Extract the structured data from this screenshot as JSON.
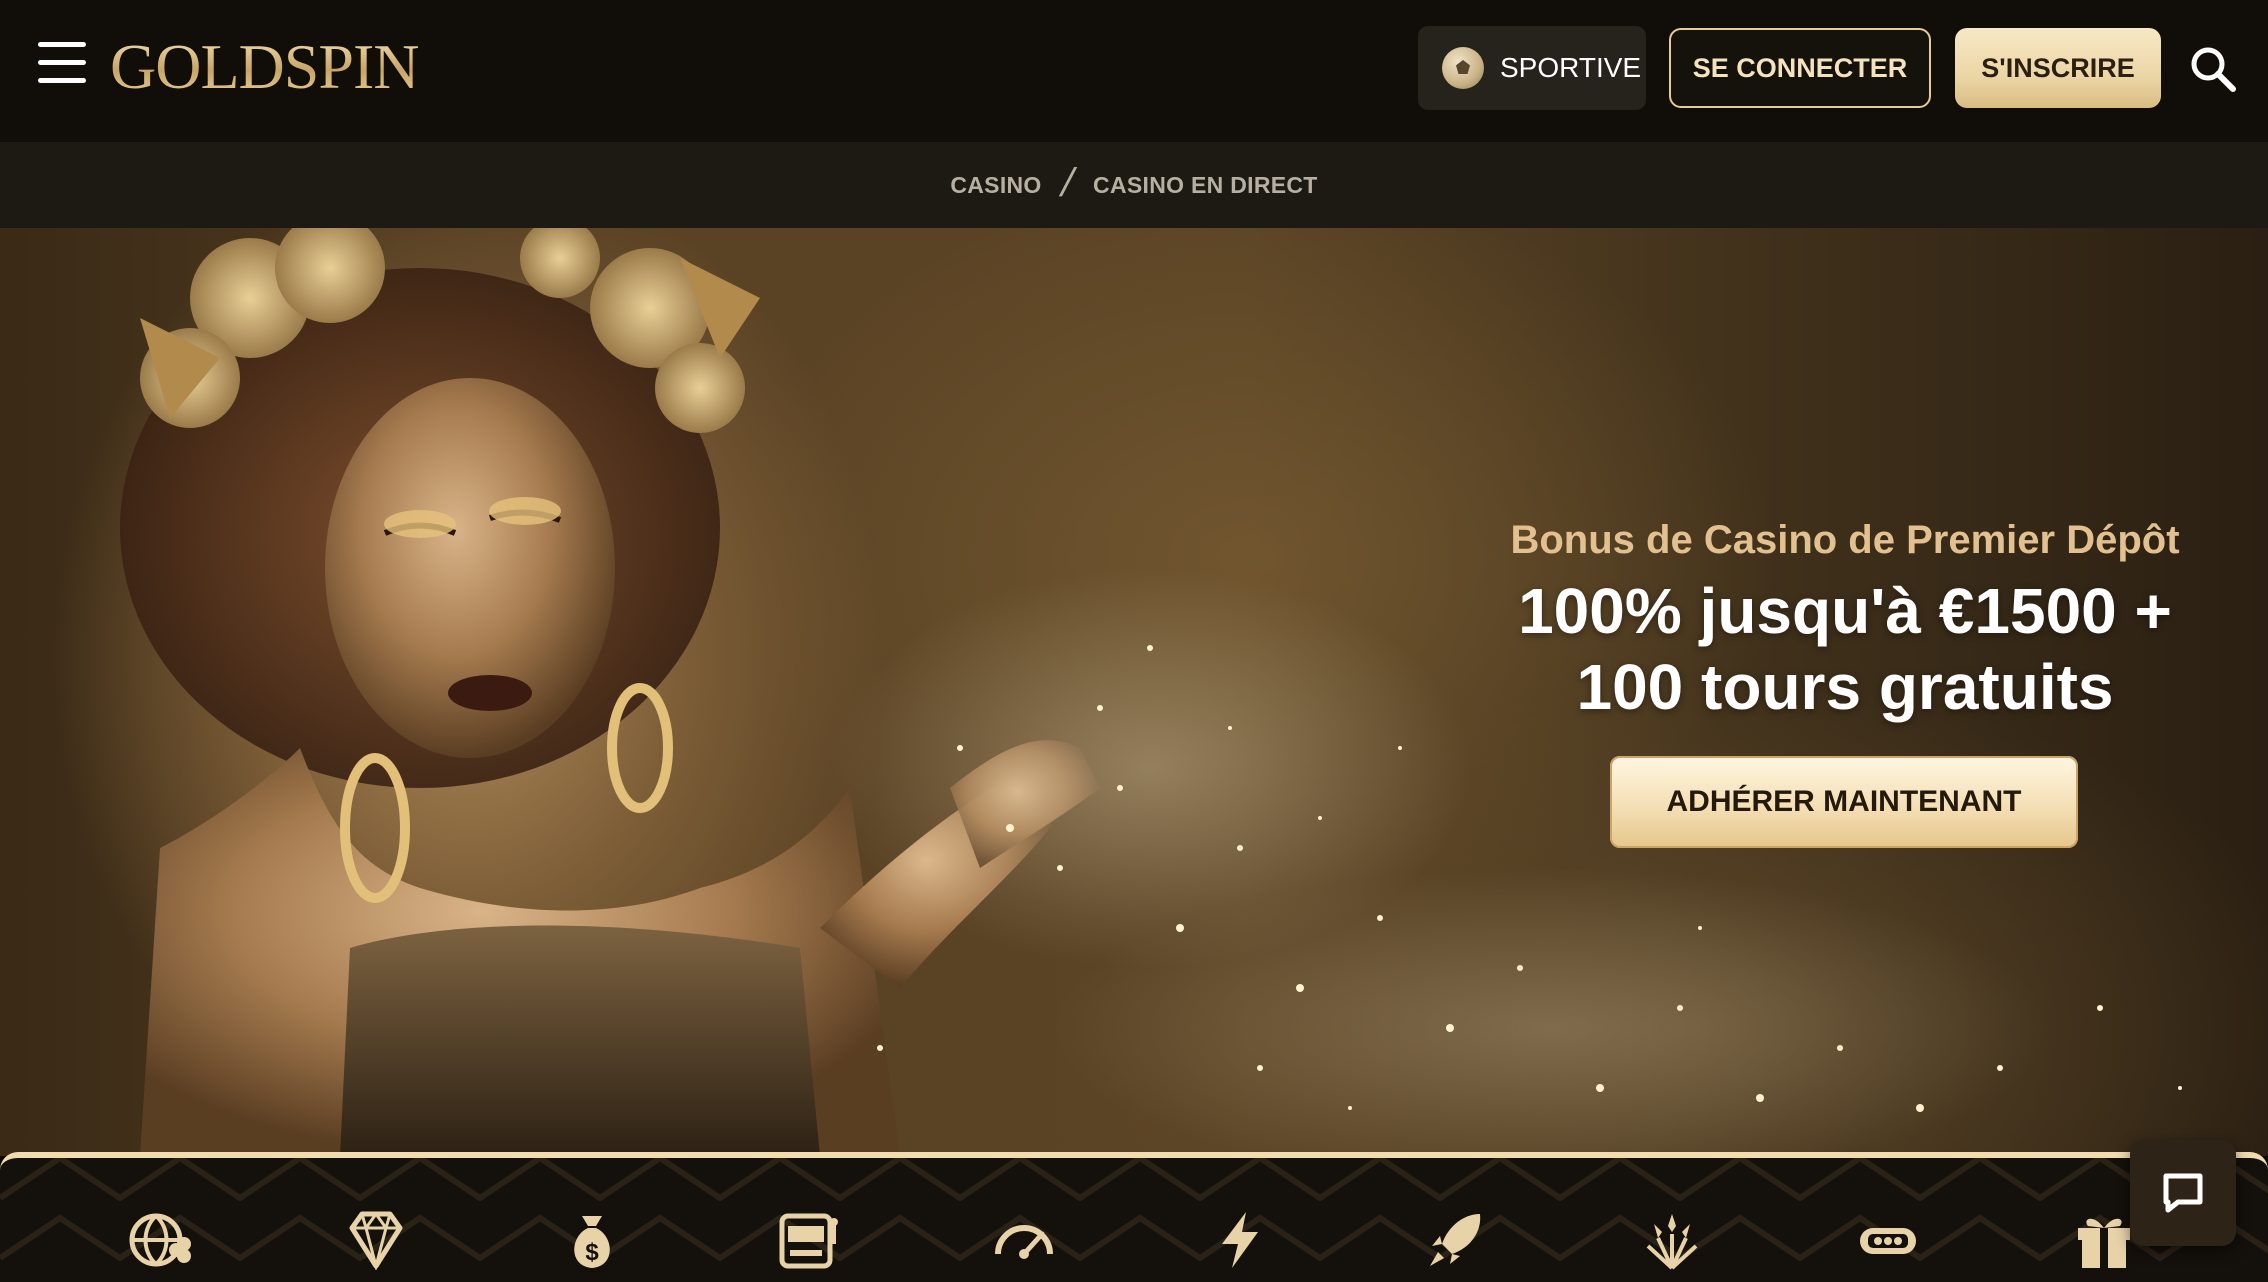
{
  "header": {
    "logo_text": "GOLDSPIN",
    "sport_label": "SPORTIVE",
    "login_label": "SE CONNECTER",
    "register_label": "S'INSCRIRE"
  },
  "breadcrumb": {
    "items": [
      "CASINO",
      "CASINO EN DIRECT"
    ],
    "separator": "/"
  },
  "hero": {
    "kicker": "Bonus de Casino de Premier Dépôt",
    "headline_line1": "100% jusqu'à €1500 +",
    "headline_line2": "100 tours gratuits",
    "cta_label": "ADHÉRER MAINTENANT"
  },
  "categories": {
    "icons": [
      "globe-clover-icon",
      "diamond-icon",
      "money-bag-icon",
      "slot-machine-icon",
      "speedometer-icon",
      "lightning-icon",
      "rocket-icon",
      "fireworks-icon",
      "ticket-icon",
      "gift-icon"
    ]
  },
  "colors": {
    "gold": "#e6cc98",
    "header_bg": "#110e09",
    "breadcrumb_bg": "#1d1a14",
    "accent_text": "#e3c08f"
  }
}
